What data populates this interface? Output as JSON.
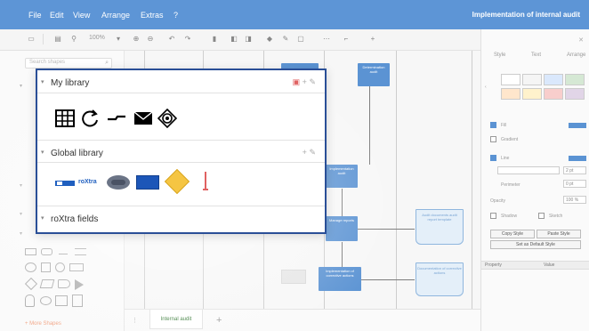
{
  "menubar": {
    "items": [
      "File",
      "Edit",
      "View",
      "Arrange",
      "Extras",
      "?"
    ],
    "document_title": "Implementation of internal audit"
  },
  "toolbar": {
    "zoom": "100%"
  },
  "sidebar": {
    "search_placeholder": "Search shapes",
    "more_shapes": "+ More Shapes"
  },
  "canvas": {
    "nodes": [
      "Determination audit",
      "Implementation audit",
      "Manage reports",
      "Implementation of corrective actions"
    ],
    "documents": [
      "Audit documents audit report template",
      "Documentation of corrective actions"
    ]
  },
  "bottom": {
    "page_tab": "Internal audit",
    "add_page": "+"
  },
  "right_panel": {
    "tabs": [
      "Style",
      "Text",
      "Arrange"
    ],
    "fill_label": "Fill",
    "gradient_label": "Gradient",
    "line_label": "Line",
    "opacity_label": "Opacity",
    "opacity_value": "100 %",
    "shadow_label": "Shadow",
    "sketch_label": "Sketch",
    "line_width": "2 pt",
    "perimeter_label": "Perimeter",
    "perimeter_value": "0 pt",
    "copy_style": "Copy Style",
    "paste_style": "Paste Style",
    "set_default": "Set as Default Style",
    "grid_headers": [
      "Property",
      "Value"
    ]
  },
  "popup": {
    "sections": [
      {
        "title": "My library"
      },
      {
        "title": "Global library"
      },
      {
        "title": "roXtra fields"
      }
    ],
    "global_text_shape": "roXtra"
  },
  "colors": {
    "menubar": "#5d95d6",
    "popup_border": "#2a4f97",
    "node_blue": "#5b93d3",
    "accent_red": "#e06262"
  }
}
